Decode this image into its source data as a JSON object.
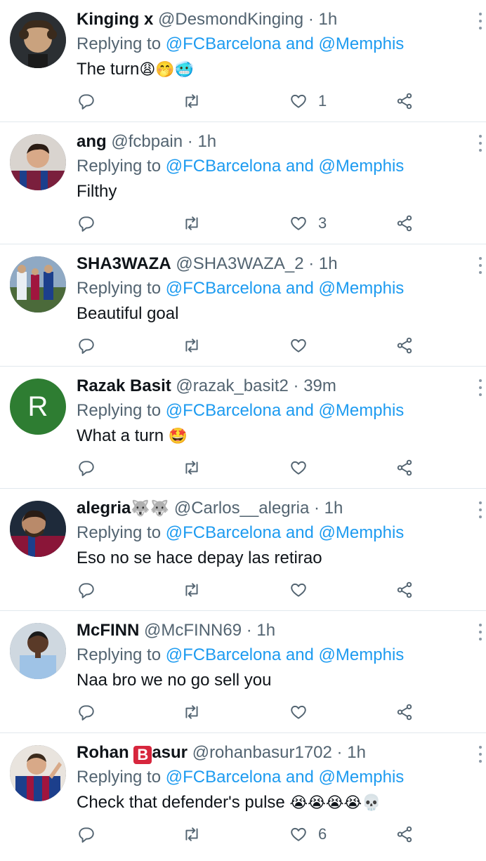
{
  "tweets": [
    {
      "name": "Kinging x",
      "handle": "@DesmondKinging",
      "time": "1h",
      "replying_prefix": "Replying to",
      "mentions": "@FCBarcelona and @Memphis",
      "text": "The turn",
      "emojis": "😩🤭🥶",
      "likes": "1"
    },
    {
      "name": "ang",
      "handle": "@fcbpain",
      "time": "1h",
      "replying_prefix": "Replying to",
      "mentions": "@FCBarcelona and @Memphis",
      "text": "Filthy",
      "likes": "3"
    },
    {
      "name": "SHA3WAZA",
      "handle": "@SHA3WAZA_2",
      "time": "1h",
      "replying_prefix": "Replying to",
      "mentions": "@FCBarcelona and @Memphis",
      "text": "Beautiful goal",
      "likes": ""
    },
    {
      "name": "Razak Basit",
      "handle": "@razak_basit2",
      "time": "39m",
      "avatar_letter": "R",
      "avatar_color": "#2e7d32",
      "replying_prefix": "Replying to",
      "mentions": "@FCBarcelona and @Memphis",
      "text": "What a turn",
      "emojis": "🤩",
      "likes": ""
    },
    {
      "name": "alegria",
      "name_emojis": "🐺🐺",
      "handle": "@Carlos__alegria",
      "time": "1h",
      "replying_prefix": "Replying to",
      "mentions": "@FCBarcelona and @Memphis",
      "text": "Eso no se hace depay las retirao",
      "likes": ""
    },
    {
      "name": "McFINN",
      "handle": "@McFINN69",
      "time": "1h",
      "replying_prefix": "Replying to",
      "mentions": "@FCBarcelona and @Memphis",
      "text": "Naa bro we no go sell you",
      "likes": ""
    },
    {
      "name_part1": "Rohan ",
      "name_badge": "B",
      "name_part2": "asur",
      "handle": "@rohanbasur1702",
      "time": "1h",
      "replying_prefix": "Replying to",
      "mentions": "@FCBarcelona and @Memphis",
      "text": "Check that defender's pulse",
      "emojis": "😭😭😭😭💀",
      "likes": "6"
    }
  ],
  "separator": "·",
  "colors": {
    "link": "#1d9bf0",
    "secondary": "#536471",
    "border": "#e1e8ed"
  }
}
